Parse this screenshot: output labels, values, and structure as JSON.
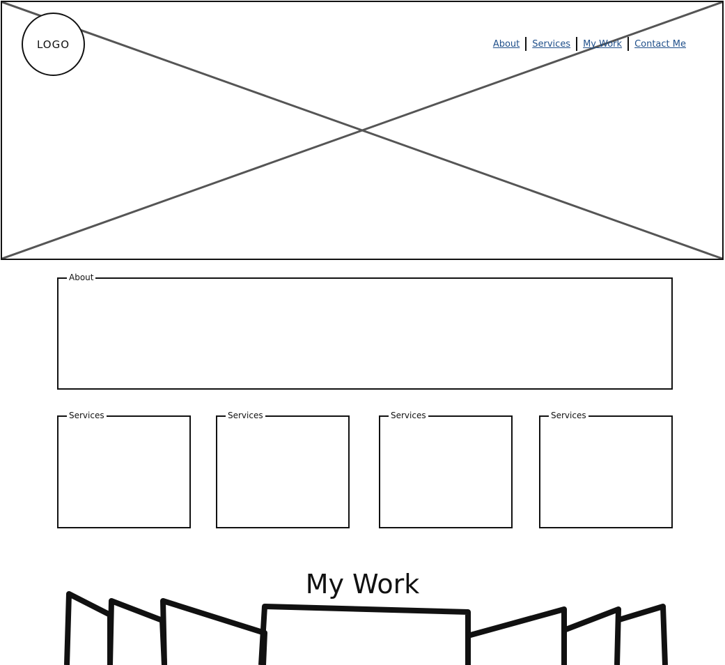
{
  "logo": {
    "text": "LOGO"
  },
  "nav": {
    "items": [
      {
        "label": "About"
      },
      {
        "label": "Services"
      },
      {
        "label": "My Work"
      },
      {
        "label": "Contact Me"
      }
    ]
  },
  "about": {
    "legend": "About"
  },
  "services": [
    {
      "legend": "Services"
    },
    {
      "legend": "Services"
    },
    {
      "legend": "Services"
    },
    {
      "legend": "Services"
    }
  ],
  "work": {
    "title": "My Work"
  }
}
